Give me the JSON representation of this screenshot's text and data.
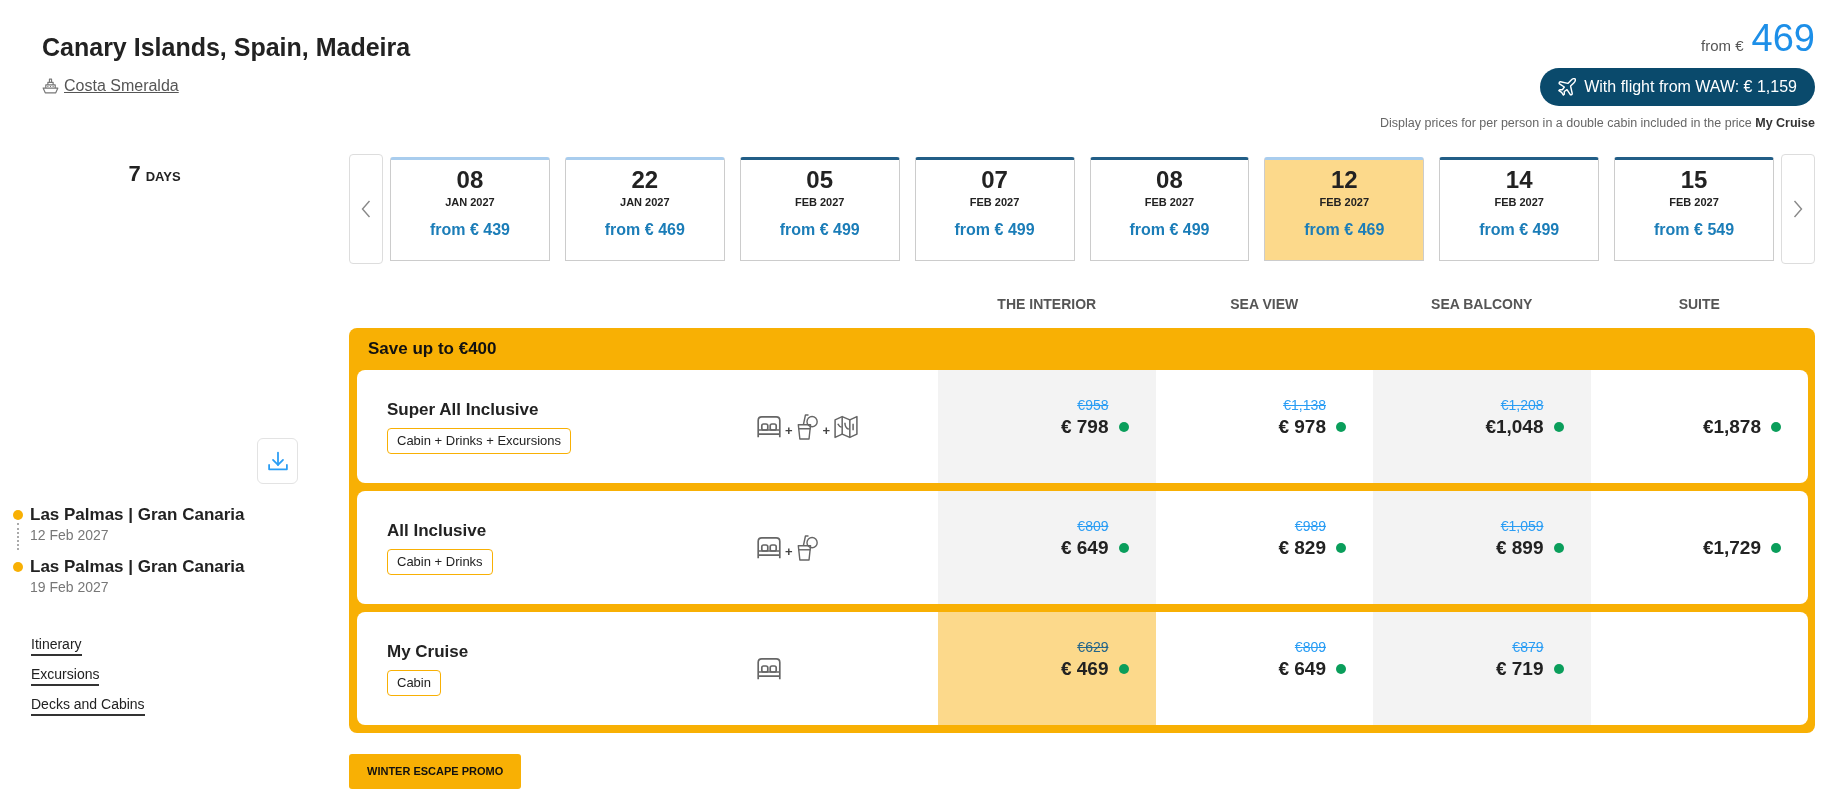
{
  "header": {
    "title": "Canary Islands, Spain, Madeira",
    "ship": "Costa Smeralda"
  },
  "price_summary": {
    "prefix": "from €",
    "amount": "469",
    "flight_button": "With flight from WAW: € 1,159",
    "note": "Display prices for per person in a double cabin included in the price **My Cruise**"
  },
  "duration": {
    "value": "7",
    "unit": "DAYS"
  },
  "dates": [
    {
      "day": "08",
      "month": "JAN 2027",
      "price": "from € 439",
      "selected": false,
      "color": "#a9cdee"
    },
    {
      "day": "22",
      "month": "JAN 2027",
      "price": "from € 469",
      "selected": false,
      "color": "#a9cdee"
    },
    {
      "day": "05",
      "month": "FEB 2027",
      "price": "from € 499",
      "selected": false,
      "color": "#225e87"
    },
    {
      "day": "07",
      "month": "FEB 2027",
      "price": "from € 499",
      "selected": false,
      "color": "#225e87"
    },
    {
      "day": "08",
      "month": "FEB 2027",
      "price": "from € 499",
      "selected": false,
      "color": "#225e87"
    },
    {
      "day": "12",
      "month": "FEB 2027",
      "price": "from € 469",
      "selected": true,
      "color": "#a9cdee"
    },
    {
      "day": "14",
      "month": "FEB 2027",
      "price": "from € 499",
      "selected": false,
      "color": "#225e87"
    },
    {
      "day": "15",
      "month": "FEB 2027",
      "price": "from € 549",
      "selected": false,
      "color": "#225e87"
    }
  ],
  "cabin_columns": [
    "THE INTERIOR",
    "SEA VIEW",
    "SEA BALCONY",
    "SUITE"
  ],
  "offer": {
    "title": "Save up to €400",
    "packages": [
      {
        "name": "Super All Inclusive",
        "tag": "Cabin + Drinks + Excursions",
        "amenities": [
          {
            "kind": "bed"
          },
          {
            "kind": "drink",
            "joiner": "+"
          },
          {
            "kind": "map",
            "joiner": "+"
          }
        ],
        "prices": [
          {
            "old": "€958",
            "price": "€ 798",
            "selected": false
          },
          {
            "old": "€1,138",
            "price": "€ 978",
            "selected": false
          },
          {
            "old": "€1,208",
            "price": "€1,048",
            "selected": false
          },
          {
            "price": "€1,878",
            "selected": false
          }
        ]
      },
      {
        "name": "All Inclusive",
        "tag": "Cabin + Drinks",
        "amenities": [
          {
            "kind": "bed"
          },
          {
            "kind": "drink",
            "joiner": "+"
          }
        ],
        "prices": [
          {
            "old": "€809",
            "price": "€ 649",
            "selected": false
          },
          {
            "old": "€989",
            "price": "€ 829",
            "selected": false
          },
          {
            "old": "€1,059",
            "price": "€ 899",
            "selected": false
          },
          {
            "price": "€1,729",
            "selected": false
          }
        ]
      },
      {
        "name": "My Cruise",
        "tag": "Cabin",
        "amenities": [
          {
            "kind": "bed"
          }
        ],
        "prices": [
          {
            "old": "€629",
            "price": "€ 469",
            "selected": true
          },
          {
            "old": "€809",
            "price": "€ 649",
            "selected": false
          },
          {
            "old": "€879",
            "price": "€ 719",
            "selected": false
          }
        ]
      }
    ]
  },
  "itinerary": [
    {
      "port": "Las Palmas | Gran Canaria",
      "date": "12 Feb 2027"
    },
    {
      "port": "Las Palmas | Gran Canaria",
      "date": "19 Feb 2027"
    }
  ],
  "links": [
    "Itinerary",
    "Excursions",
    "Decks and Cabins"
  ],
  "promo_button": "WINTER ESCAPE PROMO"
}
